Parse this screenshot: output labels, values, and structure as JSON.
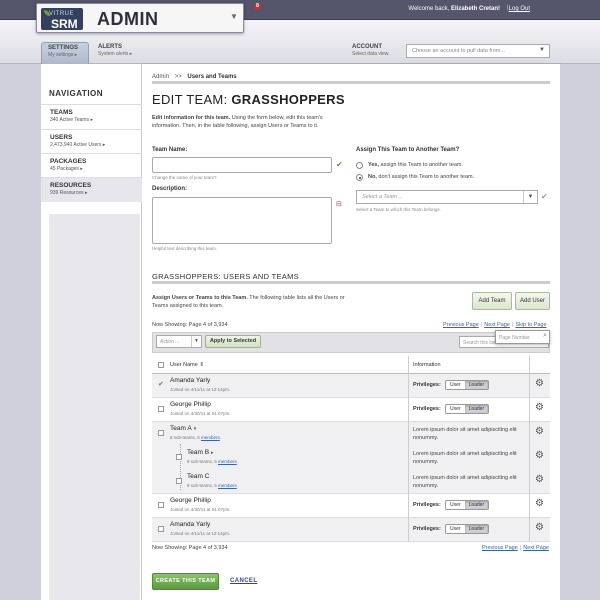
{
  "header": {
    "logo_top": "VITRUE",
    "logo_name": "SRM",
    "app_title": "ADMIN",
    "notification_count": "8",
    "welcome_prefix": "Welcome back,",
    "user_name": "Elizabeth Cretan!",
    "separator": "|",
    "logout": "Log Out"
  },
  "subnav": {
    "settings_title": "SETTINGS",
    "settings_sub": "My settings ▸",
    "alerts_title": "ALERTS",
    "alerts_sub": "System alerts ▸",
    "account_title": "ACCOUNT",
    "account_sub": "Select data view.",
    "account_placeholder": "Choose an account to pull data from..."
  },
  "sidebar": {
    "heading": "NAVIGATION",
    "items": [
      {
        "label": "TEAMS",
        "sub": "340 Active Teams ▸"
      },
      {
        "label": "USERS",
        "sub": "2,473,940 Active Users ▸"
      },
      {
        "label": "PACKAGES",
        "sub": "45 Packages ▸"
      },
      {
        "label": "RESOURCES",
        "sub": "939 Resources ▸"
      }
    ]
  },
  "breadcrumb": {
    "root": "Admin",
    "sep": ">>",
    "current": "Users and Teams"
  },
  "page": {
    "title_prefix": "EDIT TEAM: ",
    "title_name": "GRASSHOPPERS",
    "intro_bold": "Edit information for this team.",
    "intro_rest": " Using the form below, edit this team's information. Then, in the table following, assign Users or Teams to it."
  },
  "form": {
    "team_name_label": "Team Name:",
    "team_name_hint": "Change the name of your team?",
    "description_label": "Description:",
    "description_hint": "Helpful text describing this team.",
    "assign_label": "Assign This Team to Another Team?",
    "yes_bold": "Yes,",
    "yes_rest": " assign this Team to another team.",
    "no_bold": "No,",
    "no_rest": " don't assign this Team to another team.",
    "select_team_placeholder": "Select a Team ..",
    "select_team_hint": "Select a Team to which this Team belongs."
  },
  "section": {
    "title": "GRASSHOPPERS: USERS AND TEAMS",
    "desc_bold": "Assign Users or Teams to this Team.",
    "desc_rest": " The following table lists all the Users or Teams assigned to this team.",
    "add_team": "Add Team",
    "add_user": "Add User",
    "showing": "Now Showing: Page 4 of 3,934",
    "prev": "Previous Page",
    "next": "Next Page",
    "skip": "Skip to Page",
    "action_placeholder": "Action ...",
    "apply": "Apply to Selected",
    "search_placeholder": "Search this list",
    "page_number_placeholder": "Page Number",
    "col_user": "User Name ⇕",
    "col_info": "Information",
    "privileges_label": "Privileges:",
    "opt_user": "User",
    "opt_leader": "Leader"
  },
  "rows": [
    {
      "name": "Amanda Yarly",
      "sub": "Joined on 4/11/11 at 12:14pm.",
      "type": "user",
      "role": "Leader",
      "checked": true
    },
    {
      "name": "George Phillip",
      "sub": "Joined on 4/30/11 at 01:07pm.",
      "type": "user",
      "role": "Leader",
      "checked": false
    },
    {
      "name": "Team A",
      "arrow": "▾",
      "sub_prefix": "8 sub-teams, 6 ",
      "sub_link": "members",
      "info": "Lorem ipsum dolor sit amet adipisciting elit nonummy.",
      "type": "team"
    },
    {
      "name": "Team B",
      "arrow": "▸",
      "sub_prefix": "8 sub-teams, 6 ",
      "sub_link": "members",
      "info": "Lorem ipsum dolor sit amet adipisciting elit nonummy.",
      "type": "team"
    },
    {
      "name": "Team C",
      "sub_prefix": "8 sub-teams, 6 ",
      "sub_link": "members",
      "info": "Lorem ipsum dolor sit amet adipisciting elit nonummy.",
      "type": "team"
    },
    {
      "name": "George Phillip",
      "sub": "Joined on 4/30/11 at 01:07pm.",
      "type": "user",
      "role": "Leader",
      "checked": false
    },
    {
      "name": "Amanda Yarly",
      "sub": "Joined on 4/11/11 at 12:14pm.",
      "type": "user",
      "role": "Leader",
      "checked": false
    }
  ],
  "footer": {
    "showing": "Now Showing: Page 4 of 3,934",
    "prev": "Previous Page",
    "next": "Next Page",
    "create": "CREATE THIS TEAM",
    "cancel": "CANCEL"
  },
  "colors": {
    "topbar": "#55556c",
    "green_button": "#5a9a3c",
    "link": "#3a64a8"
  }
}
